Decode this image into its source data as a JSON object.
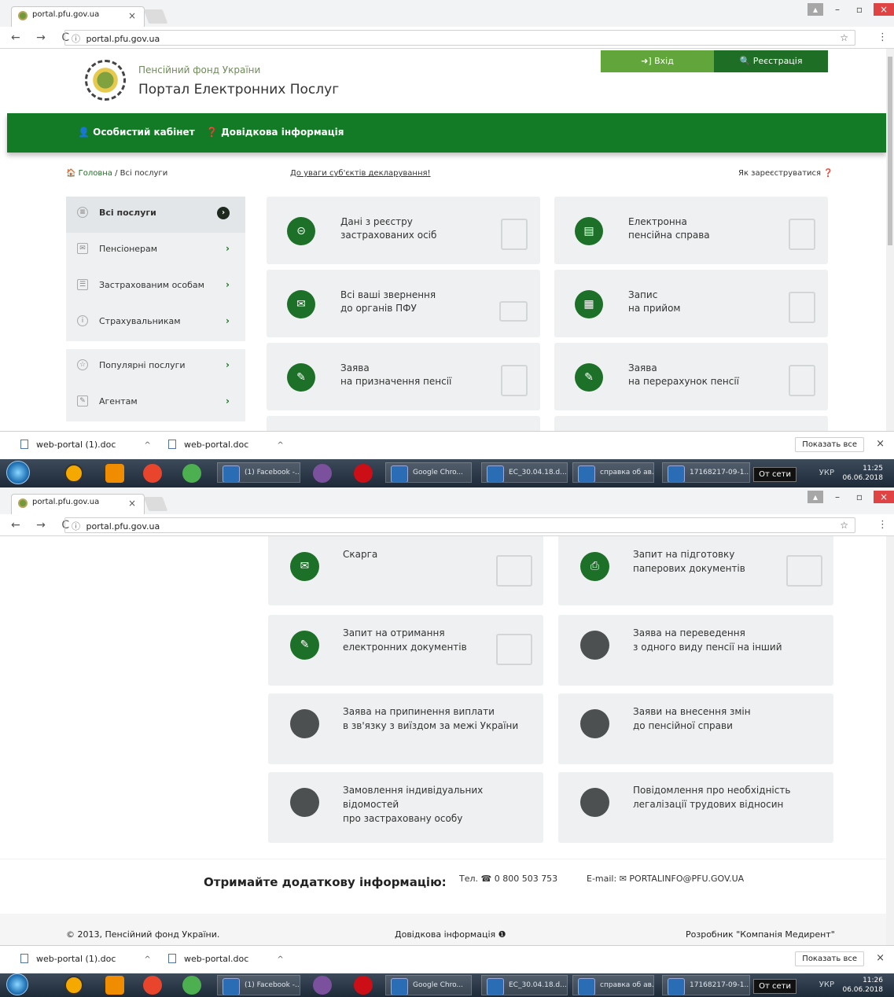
{
  "browser": {
    "tab_title": "portal.pfu.gov.ua",
    "tab_close": "×",
    "url": "portal.pfu.gov.ua",
    "nav_symbols": "← → C",
    "info_symbol": "ⓘ",
    "menu_symbol": "⋮",
    "bookmark_symbol": "☆",
    "win_minimize": "–",
    "win_restore": "▫",
    "win_close": "×",
    "win_user": "▴"
  },
  "site": {
    "org_name": "Пенсійний фонд України",
    "portal_title": "Портал Електронних Послуг",
    "login": "➜] Вхід",
    "register": "🔍 Реєстрація",
    "nav_cabinet": "👤 Особистий кабінет",
    "nav_help": "❓ Довідкова інформація"
  },
  "breadcrumbs": {
    "home": "🏠 Головна",
    "sep": " / ",
    "current": "Всі послуги"
  },
  "notice_link": "До уваги суб'єктів декларування!",
  "howto_link": "Як зареєструватися ❓",
  "sidebar": {
    "group1": [
      {
        "label": "Всі послуги",
        "icon": "≡"
      },
      {
        "label": "Пенсіонерам",
        "icon": "✉"
      },
      {
        "label": "Застрахованим особам",
        "icon": "☰"
      },
      {
        "label": "Страхувальникам",
        "icon": "i"
      }
    ],
    "group2": [
      {
        "label": "Популярні послуги",
        "icon": "☆"
      },
      {
        "label": "Агентам",
        "icon": "✎"
      }
    ],
    "arrow": "›",
    "arrow_active": "›"
  },
  "cards_top": [
    {
      "line1": "Дані з реєстру",
      "line2": "застрахованих осіб",
      "icon": "⊝"
    },
    {
      "line1": "Електронна",
      "line2": "пенсійна справа",
      "icon": "▤"
    },
    {
      "line1": "Всі ваші звернення",
      "line2": "до органів ПФУ",
      "icon": "✉"
    },
    {
      "line1": "Запис",
      "line2": "на прийом",
      "icon": "▦"
    },
    {
      "line1": "Заява",
      "line2": "на призначення пенсії",
      "icon": "✎"
    },
    {
      "line1": "Заява",
      "line2": "на перерахунок пенсії",
      "icon": "✎"
    }
  ],
  "cards_bottom": [
    {
      "line1": "Скарга",
      "line2": "",
      "icon": "✉"
    },
    {
      "line1": "Запит на підготовку",
      "line2": "паперових документів",
      "icon": "⎙"
    },
    {
      "line1": "Запит на отримання",
      "line2": "електронних документів",
      "icon": "✎"
    },
    {
      "line1": "Заява на переведення",
      "line2": "з одного виду пенсії на інший",
      "icon": ""
    },
    {
      "line1": "Заява на припинення виплати",
      "line2": "в зв'язку з виїздом за межі України",
      "icon": ""
    },
    {
      "line1": "Заяви на внесення змін",
      "line2": "до пенсійної справи",
      "icon": ""
    },
    {
      "line1": "Замовлення індивідуальних відомостей",
      "line2": "про застраховану особу",
      "icon": ""
    },
    {
      "line1": "Повідомлення про необхідність",
      "line2": "легалізації трудових відносин",
      "icon": ""
    }
  ],
  "footer": {
    "more_info": "Отримайте додаткову інформацію:",
    "phone": "Тел. ☎ 0 800 503 753",
    "email": "E-mail: ✉ PORTALINFO@PFU.GOV.UA",
    "copyright": "© 2013, Пенсійний фонд України.",
    "help": "Довідкова інформація ❶",
    "developer": "Розробник \"Компанія Медирент\""
  },
  "downloads": {
    "file1": "web-portal (1).doc",
    "file2": "web-portal.doc",
    "caret": "^",
    "show_all": "Показать все",
    "close": "×"
  },
  "taskbar": {
    "facebook": "(1) Facebook -...",
    "chrome": "Google Chro...",
    "doc1": "ЕС_30.04.18.d...",
    "doc2": "справка об ав...",
    "doc3": "17168217-09-1...",
    "offline": "От сети",
    "lang": "УКР",
    "time1": "11:25",
    "time2": "11:26",
    "date": "06.06.2018"
  },
  "colors": {
    "brand_green": "#137b25",
    "dark_green": "#1d7028",
    "light_green": "#61a53b",
    "card_bg": "#eef0f1"
  }
}
